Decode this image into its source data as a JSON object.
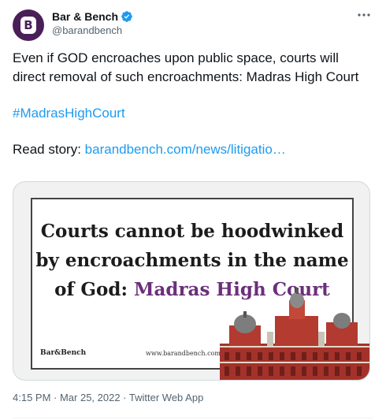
{
  "author": {
    "display_name": "Bar & Bench",
    "handle": "@barandbench",
    "avatar_letter": "B",
    "verified": true
  },
  "tweet": {
    "text": "Even if GOD encroaches upon public space, courts will direct removal of such encroachments: Madras High Court",
    "hashtag": "#MadrasHighCourt",
    "read_story_label": "Read story:",
    "link_text": "barandbench.com/news/litigatio…"
  },
  "card": {
    "headline_part1": "Courts cannot be hoodwinked by encroachments in the name of God:",
    "headline_accent": "Madras High Court",
    "logo_text": "Bar&Bench",
    "site_url": "www.barandbench.com"
  },
  "meta": {
    "timestamp": "4:15 PM · Mar 25, 2022 · Twitter Web App"
  },
  "colors": {
    "link": "#1d9bf0",
    "verified": "#1d9bf0",
    "avatar_bg": "#4a1f57",
    "headline_accent": "#6b2f7b",
    "building": "#a4322a"
  }
}
